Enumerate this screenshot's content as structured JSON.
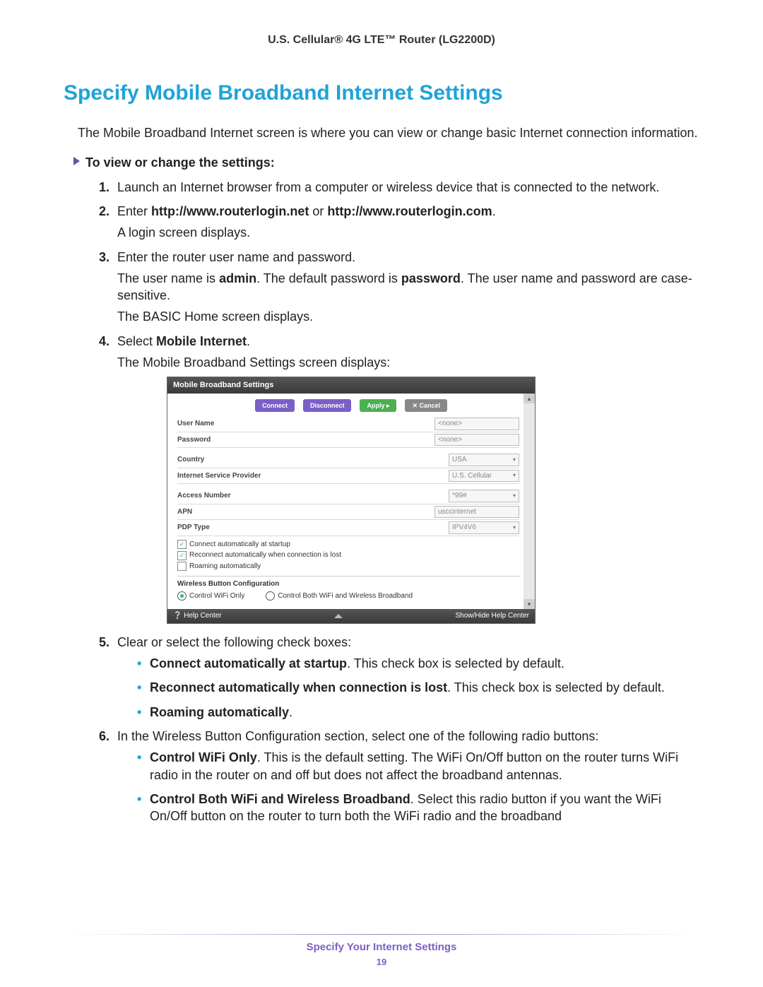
{
  "header": {
    "title": "U.S. Cellular® 4G LTE™ Router (LG2200D)"
  },
  "section": {
    "title": "Specify Mobile Broadband Internet Settings",
    "intro": "The Mobile Broadband Internet screen is where you can view or change basic Internet connection information.",
    "procedure_label": "To view or change the settings:"
  },
  "steps": {
    "s1_text": "Launch an Internet browser from a computer or wireless device that is connected to the network.",
    "s2_prefix": "Enter ",
    "s2_url1": "http://www.routerlogin.net",
    "s2_mid": " or ",
    "s2_url2": "http://www.routerlogin.com",
    "s2_suffix": ".",
    "s2_sub": "A login screen displays.",
    "s3_text": "Enter the router user name and password.",
    "s3_p1a": "The user name is ",
    "s3_p1b": "admin",
    "s3_p1c": ". The default password is ",
    "s3_p1d": "password",
    "s3_p1e": ". The user name and password are case-sensitive.",
    "s3_p2": "The BASIC Home screen displays.",
    "s4_prefix": "Select ",
    "s4_bold": "Mobile Internet",
    "s4_suffix": ".",
    "s4_sub": "The Mobile Broadband Settings screen displays:",
    "s5_text": "Clear or select the following check boxes:",
    "s5_b1_bold": "Connect automatically at startup",
    "s5_b1_rest": ". This check box is selected by default.",
    "s5_b2_bold": "Reconnect automatically when connection is lost",
    "s5_b2_rest": ". This check box is selected by default.",
    "s5_b3_bold": "Roaming automatically",
    "s5_b3_rest": ".",
    "s6_text": "In the Wireless Button Configuration section, select one of the following radio buttons:",
    "s6_b1_bold": "Control WiFi Only",
    "s6_b1_rest": ". This is the default setting. The WiFi On/Off button on the router turns WiFi radio in the router on and off but does not affect the broadband antennas.",
    "s6_b2_bold": "Control Both WiFi and Wireless Broadband",
    "s6_b2_rest": ". Select this radio button if you want the WiFi On/Off button on the router to turn both the WiFi radio and the broadband"
  },
  "embed": {
    "title": "Mobile Broadband Settings",
    "btn_connect": "Connect",
    "btn_disconnect": "Disconnect",
    "btn_apply": "Apply ▸",
    "btn_cancel": "✕ Cancel",
    "labels": {
      "username": "User Name",
      "password": "Password",
      "country": "Country",
      "isp": "Internet Service Provider",
      "access": "Access Number",
      "apn": "APN",
      "pdp": "PDP Type"
    },
    "values": {
      "username": "<none>",
      "password": "<none>",
      "country": "USA",
      "isp": "U.S. Cellular",
      "access": "*99#",
      "apn": "usccinternet",
      "pdp": "IPV4V6"
    },
    "checks": {
      "c1": "Connect automatically at startup",
      "c2": "Reconnect automatically when connection is lost",
      "c3": "Roaming automatically"
    },
    "wbc_title": "Wireless Button Configuration",
    "wbc_opt1": "Control WiFi Only",
    "wbc_opt2": "Control Both WiFi and Wireless Broadband",
    "help": "❔ Help Center",
    "showhide": "Show/Hide Help Center"
  },
  "footer": {
    "title": "Specify Your Internet Settings",
    "page": "19"
  }
}
